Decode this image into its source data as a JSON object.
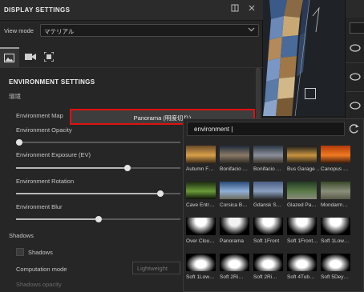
{
  "panel": {
    "title": "DISPLAY SETTINGS",
    "view_mode_label": "View mode",
    "view_mode_value": "マテリアル",
    "section_title": "ENVIRONMENT SETTINGS",
    "section_sub": "環境",
    "env_map_label": "Environment Map",
    "env_map_value": "Panorama (明度切り)",
    "opacity_label": "Environment Opacity",
    "opacity_value": 0.02,
    "exposure_label": "Environment Exposure (EV)",
    "exposure_value": 0.68,
    "rotation_label": "Environment Rotation",
    "rotation_value": 0.88,
    "blur_label": "Environment Blur",
    "blur_value": 0.5,
    "shadows_header": "Shadows",
    "shadows_checkbox_label": "Shadows",
    "computation_label": "Computation mode",
    "computation_value": "Lightweight",
    "shadows_opacity_label": "Shadows opacity"
  },
  "popup": {
    "search_value": "environment |",
    "items": [
      {
        "name": "Autumn F…",
        "colors": [
          "#6a4a2a",
          "#d9a04a",
          "#3c2a18"
        ]
      },
      {
        "name": "Bonifacio …",
        "colors": [
          "#1d2a3c",
          "#8a7a66",
          "#2e2a24"
        ]
      },
      {
        "name": "Bonifacio …",
        "colors": [
          "#2a3644",
          "#8b8f9a",
          "#3a3226"
        ]
      },
      {
        "name": "Bus Garage …",
        "colors": [
          "#1a1a1a",
          "#c79440",
          "#2c2418"
        ]
      },
      {
        "name": "Canopus …",
        "colors": [
          "#b23a0a",
          "#f07a22",
          "#3a1a0a"
        ]
      },
      {
        "name": "Cave Entr…",
        "colors": [
          "#1c2a10",
          "#6a9a3a",
          "#0c1206"
        ]
      },
      {
        "name": "Corsica B…",
        "colors": [
          "#2a4a78",
          "#8fb0d8",
          "#6a6a5a"
        ]
      },
      {
        "name": "Gdansk S…",
        "colors": [
          "#4a5e86",
          "#8aa0c0",
          "#2a2a2a"
        ]
      },
      {
        "name": "Glazed Pa…",
        "colors": [
          "#223a22",
          "#5a7a4a",
          "#8a8a7a"
        ]
      },
      {
        "name": "Mondarm…",
        "colors": [
          "#3a4a2a",
          "#8a8f7a",
          "#5a5a4a"
        ]
      },
      {
        "name": "Over Clou…",
        "colors": [
          "#000000",
          "#ffffff",
          "#000000"
        ]
      },
      {
        "name": "Panorama",
        "colors": [
          "#000000",
          "#f2f2f2",
          "#111111"
        ]
      },
      {
        "name": "Soft 1Front",
        "colors": [
          "#000000",
          "#ffffff",
          "#000000"
        ]
      },
      {
        "name": "Soft 1Front…",
        "colors": [
          "#000000",
          "#ffffff",
          "#000000"
        ]
      },
      {
        "name": "Soft 1Low…",
        "colors": [
          "#000000",
          "#ffffff",
          "#000000"
        ]
      },
      {
        "name": "Soft 1Low…",
        "colors": [
          "#000000",
          "#ffffff",
          "#000000"
        ]
      },
      {
        "name": "Soft 2Ri…",
        "colors": [
          "#000000",
          "#ffffff",
          "#000000"
        ]
      },
      {
        "name": "Soft 2Ri…",
        "colors": [
          "#000000",
          "#ffffff",
          "#000000"
        ]
      },
      {
        "name": "Soft 4Tub…",
        "colors": [
          "#000000",
          "#ffffff",
          "#000000"
        ]
      },
      {
        "name": "Soft 5Dey…",
        "colors": [
          "#000000",
          "#ffffff",
          "#000000"
        ]
      }
    ]
  },
  "theme": {
    "highlight": "#e01010",
    "panel_bg": "#262626",
    "icons": [
      "image-icon",
      "video-camera-icon",
      "frame-icon",
      "dock-icon",
      "close-icon",
      "refresh-icon",
      "chevron-down-icon"
    ]
  }
}
